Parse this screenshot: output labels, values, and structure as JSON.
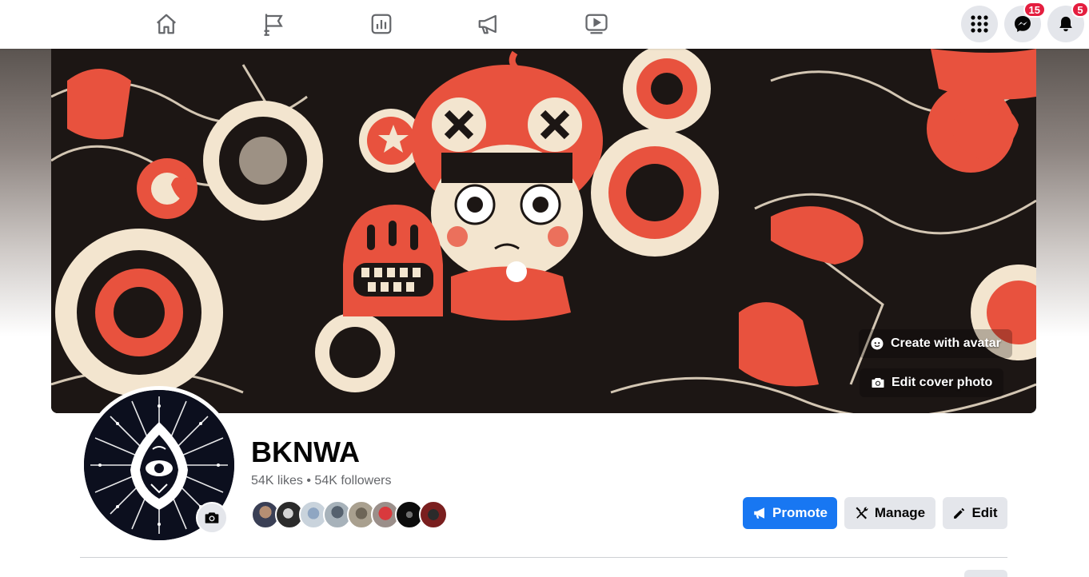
{
  "nav": {
    "items": [
      {
        "icon": "home-icon"
      },
      {
        "icon": "flag-icon"
      },
      {
        "icon": "insights-icon"
      },
      {
        "icon": "megaphone-icon"
      },
      {
        "icon": "video-icon"
      }
    ],
    "menu_icon": "grid-menu-icon",
    "messenger_badge": "15",
    "notifications_badge": "5"
  },
  "cover": {
    "create_avatar_label": "Create with avatar",
    "edit_cover_label": "Edit cover photo"
  },
  "page": {
    "name": "BKNWA",
    "stats": "54K likes • 54K followers"
  },
  "actions": {
    "promote_label": "Promote",
    "manage_label": "Manage",
    "edit_label": "Edit"
  },
  "colors": {
    "primary": "#1877f2",
    "secondary_button": "#e4e6eb",
    "badge": "#e41e3f",
    "cover_red": "#e8523e",
    "cover_cream": "#f3e5cf"
  }
}
